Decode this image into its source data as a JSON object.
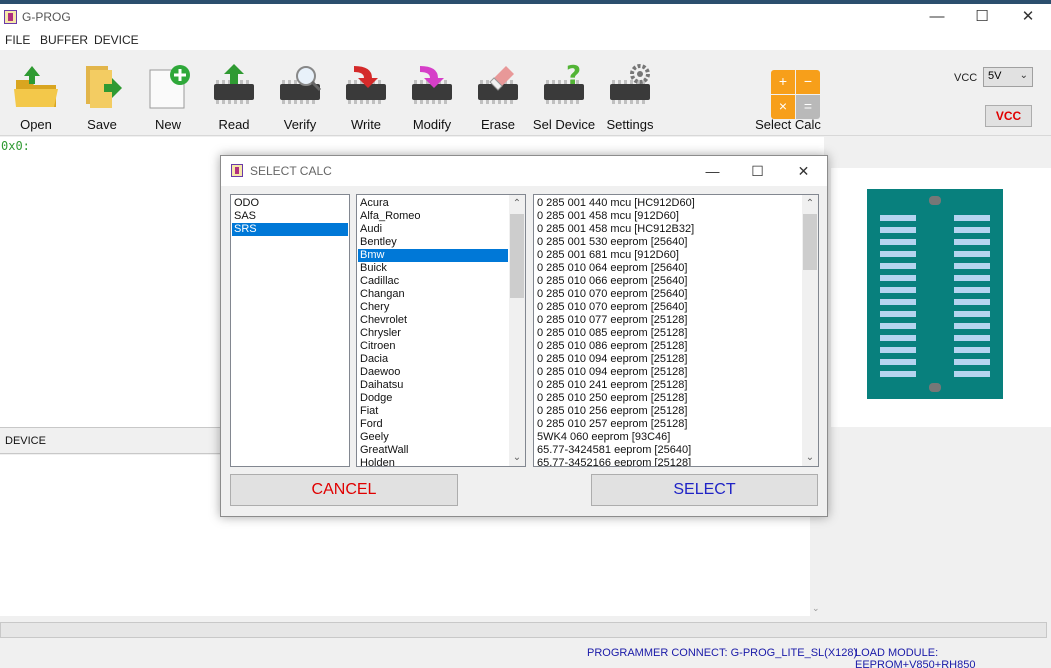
{
  "window": {
    "title": "G-PROG",
    "controls": {
      "minimize": "—",
      "maximize": "☐",
      "close": "✕"
    }
  },
  "menu": [
    "FILE",
    "BUFFER",
    "DEVICE"
  ],
  "toolbar": {
    "buttons": [
      {
        "label": "Open",
        "icon": "open-folder-icon"
      },
      {
        "label": "Save",
        "icon": "save-folder-icon"
      },
      {
        "label": "New",
        "icon": "new-file-icon"
      },
      {
        "label": "Read",
        "icon": "read-chip-icon"
      },
      {
        "label": "Verify",
        "icon": "verify-chip-icon"
      },
      {
        "label": "Write",
        "icon": "write-chip-icon"
      },
      {
        "label": "Modify",
        "icon": "modify-chip-icon"
      },
      {
        "label": "Erase",
        "icon": "erase-chip-icon"
      },
      {
        "label": "Sel Device",
        "icon": "select-device-icon"
      },
      {
        "label": "Settings",
        "icon": "settings-gear-icon"
      },
      {
        "label": "Select Calc",
        "icon": "calculator-icon"
      }
    ],
    "calc_symbols": {
      "plus": "+",
      "minus": "−",
      "times": "×",
      "equals": "="
    },
    "vcc_label": "VCC",
    "vcc_value": "5V",
    "vcc_button": "VCC"
  },
  "hex_view": {
    "text": "0x0:"
  },
  "device_panel": {
    "header": "DEVICE"
  },
  "statusbar": {
    "programmer": "PROGRAMMER CONNECT:   G-PROG_LITE_SL(X128)",
    "module": "LOAD MODULE: EEPROM+V850+RH850"
  },
  "colors": {
    "selection": "#0078d7",
    "cancel_text": "#e00000",
    "select_text": "#1f23c6",
    "socket": "#08807d",
    "hex_text": "#2f9a32",
    "status_text": "#1a1aa8"
  },
  "dialog": {
    "title": "SELECT CALC",
    "categories": [
      "ODO",
      "SAS",
      "SRS"
    ],
    "selected_category": 2,
    "brands": [
      "Acura",
      "Alfa_Romeo",
      "Audi",
      "Bentley",
      "Bmw",
      "Buick",
      "Cadillac",
      "Changan",
      "Chery",
      "Chevrolet",
      "Chrysler",
      "Citroen",
      "Dacia",
      "Daewoo",
      "Daihatsu",
      "Dodge",
      "Fiat",
      "Ford",
      "Geely",
      "GreatWall",
      "Holden"
    ],
    "selected_brand": 4,
    "modules": [
      "0 285 001 440 mcu [HC912D60]",
      "0 285 001 458 mcu [912D60]",
      "0 285 001 458 mcu [HC912B32]",
      "0 285 001 530 eeprom [25640]",
      "0 285 001 681 mcu [912D60]",
      "0 285 010 064 eeprom [25640]",
      "0 285 010 066 eeprom [25640]",
      "0 285 010 070 eeprom [25640]",
      "0 285 010 070 eeprom [25640]",
      "0 285 010 077 eeprom [25128]",
      "0 285 010 085 eeprom [25128]",
      "0 285 010 086 eeprom [25128]",
      "0 285 010 094 eeprom [25128]",
      "0 285 010 094 eeprom [25128]",
      "0 285 010 241 eeprom [25128]",
      "0 285 010 250 eeprom [25128]",
      "0 285 010 256 eeprom [25128]",
      "0 285 010 257 eeprom [25128]",
      "5WK4 060 eeprom [93C46]",
      "65.77-3424581 eeprom [25640]",
      "65.77-3452166 eeprom [25128]"
    ],
    "cancel_label": "CANCEL",
    "select_label": "SELECT"
  }
}
